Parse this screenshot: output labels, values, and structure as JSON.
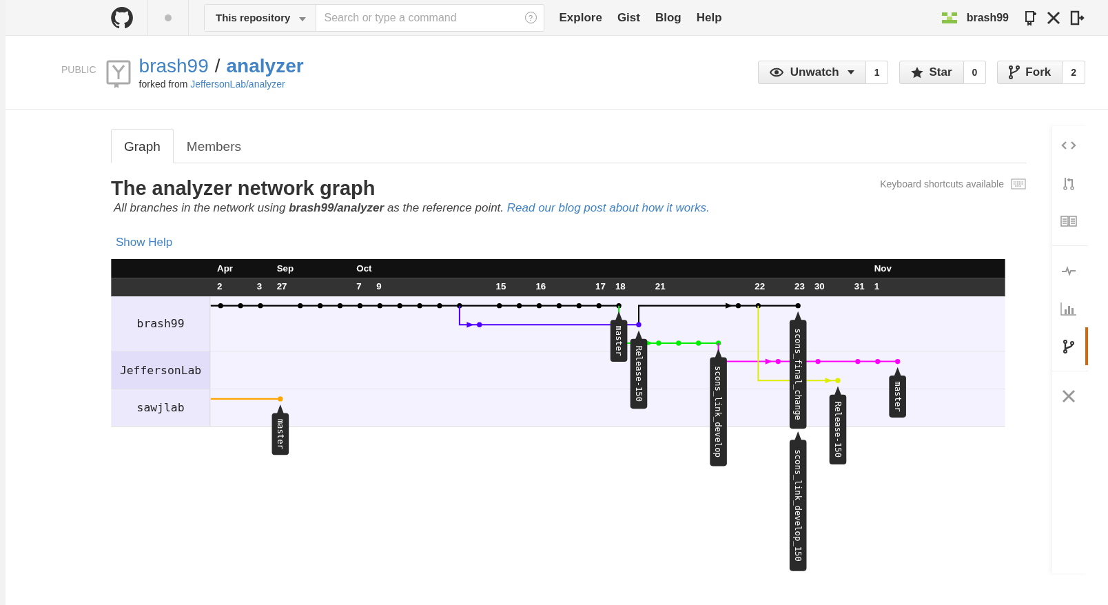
{
  "header": {
    "scope": "This repository",
    "search": {
      "placeholder": "Search or type a command"
    },
    "help": "?",
    "nav": [
      "Explore",
      "Gist",
      "Blog",
      "Help"
    ],
    "user": "brash99"
  },
  "repo": {
    "visibility": "PUBLIC",
    "owner": "brash99",
    "separator": "/",
    "name": "analyzer",
    "forked_prefix": "forked from",
    "forked_from": "JeffersonLab/analyzer",
    "actions": [
      {
        "label": "Unwatch",
        "count": "1",
        "kind": "watch"
      },
      {
        "label": "Star",
        "count": "0",
        "kind": "star"
      },
      {
        "label": "Fork",
        "count": "2",
        "kind": "fork"
      }
    ]
  },
  "tabs": [
    {
      "label": "Graph",
      "selected": true
    },
    {
      "label": "Members",
      "selected": false
    }
  ],
  "title": "The analyzer network graph",
  "subtitle": "All branches in the network using **brash99/analyzer** as the reference point.",
  "blog_link": "Read our blog post about how it works.",
  "shortcuts": "Keyboard shortcuts available",
  "show_help": "Show Help",
  "graph": {
    "months": [
      "Apr",
      "Sep",
      "Oct",
      "Nov"
    ],
    "days": [
      "2",
      "3",
      "27",
      "7",
      "9",
      "15",
      "16",
      "17",
      "18",
      "21",
      "22",
      "23",
      "30",
      "31",
      "1"
    ],
    "users": [
      {
        "name": "brash99"
      },
      {
        "name": "JeffersonLab"
      },
      {
        "name": "sawjlab"
      }
    ],
    "tags": [
      {
        "label": "master"
      },
      {
        "label": "Release-150"
      },
      {
        "label": "scons_link_develop"
      },
      {
        "label": "scons_final_change"
      },
      {
        "label": "scons_link_develop_150"
      },
      {
        "label": "Release-150"
      },
      {
        "label": "master"
      },
      {
        "label": "master"
      }
    ]
  },
  "sidebar": [
    {
      "kind": "code",
      "selected": false
    },
    {
      "kind": "pull",
      "selected": false
    },
    {
      "kind": "wiki",
      "selected": false
    },
    {
      "kind": "pulse",
      "selected": false
    },
    {
      "kind": "graphs",
      "selected": false
    },
    {
      "kind": "network",
      "selected": true
    },
    {
      "kind": "settings",
      "selected": false
    }
  ]
}
